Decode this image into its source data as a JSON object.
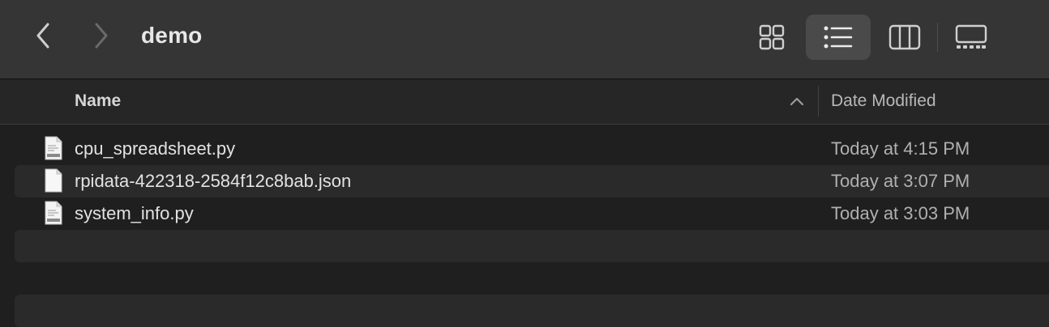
{
  "toolbar": {
    "title": "demo",
    "back_icon": "chevron-left-icon",
    "forward_icon": "chevron-right-icon",
    "views": [
      {
        "name": "icons-view-icon",
        "selected": false
      },
      {
        "name": "list-view-icon",
        "selected": true
      },
      {
        "name": "columns-view-icon",
        "selected": false
      },
      {
        "name": "gallery-view-icon",
        "selected": false
      }
    ]
  },
  "columns": {
    "name_label": "Name",
    "date_label": "Date Modified",
    "sort_direction": "ascending"
  },
  "files": [
    {
      "name": "cpu_spreadsheet.py",
      "date": "Today at 4:15 PM",
      "icon": "python-file-icon"
    },
    {
      "name": "rpidata-422318-2584f12c8bab.json",
      "date": "Today at 3:07 PM",
      "icon": "json-file-icon"
    },
    {
      "name": "system_info.py",
      "date": "Today at 3:03 PM",
      "icon": "python-file-icon"
    }
  ],
  "colors": {
    "toolbar_bg": "#353535",
    "window_bg": "#1f1f1f",
    "row_alt_bg": "#2a2a2a",
    "selected_view_bg": "#4a4a4a"
  }
}
